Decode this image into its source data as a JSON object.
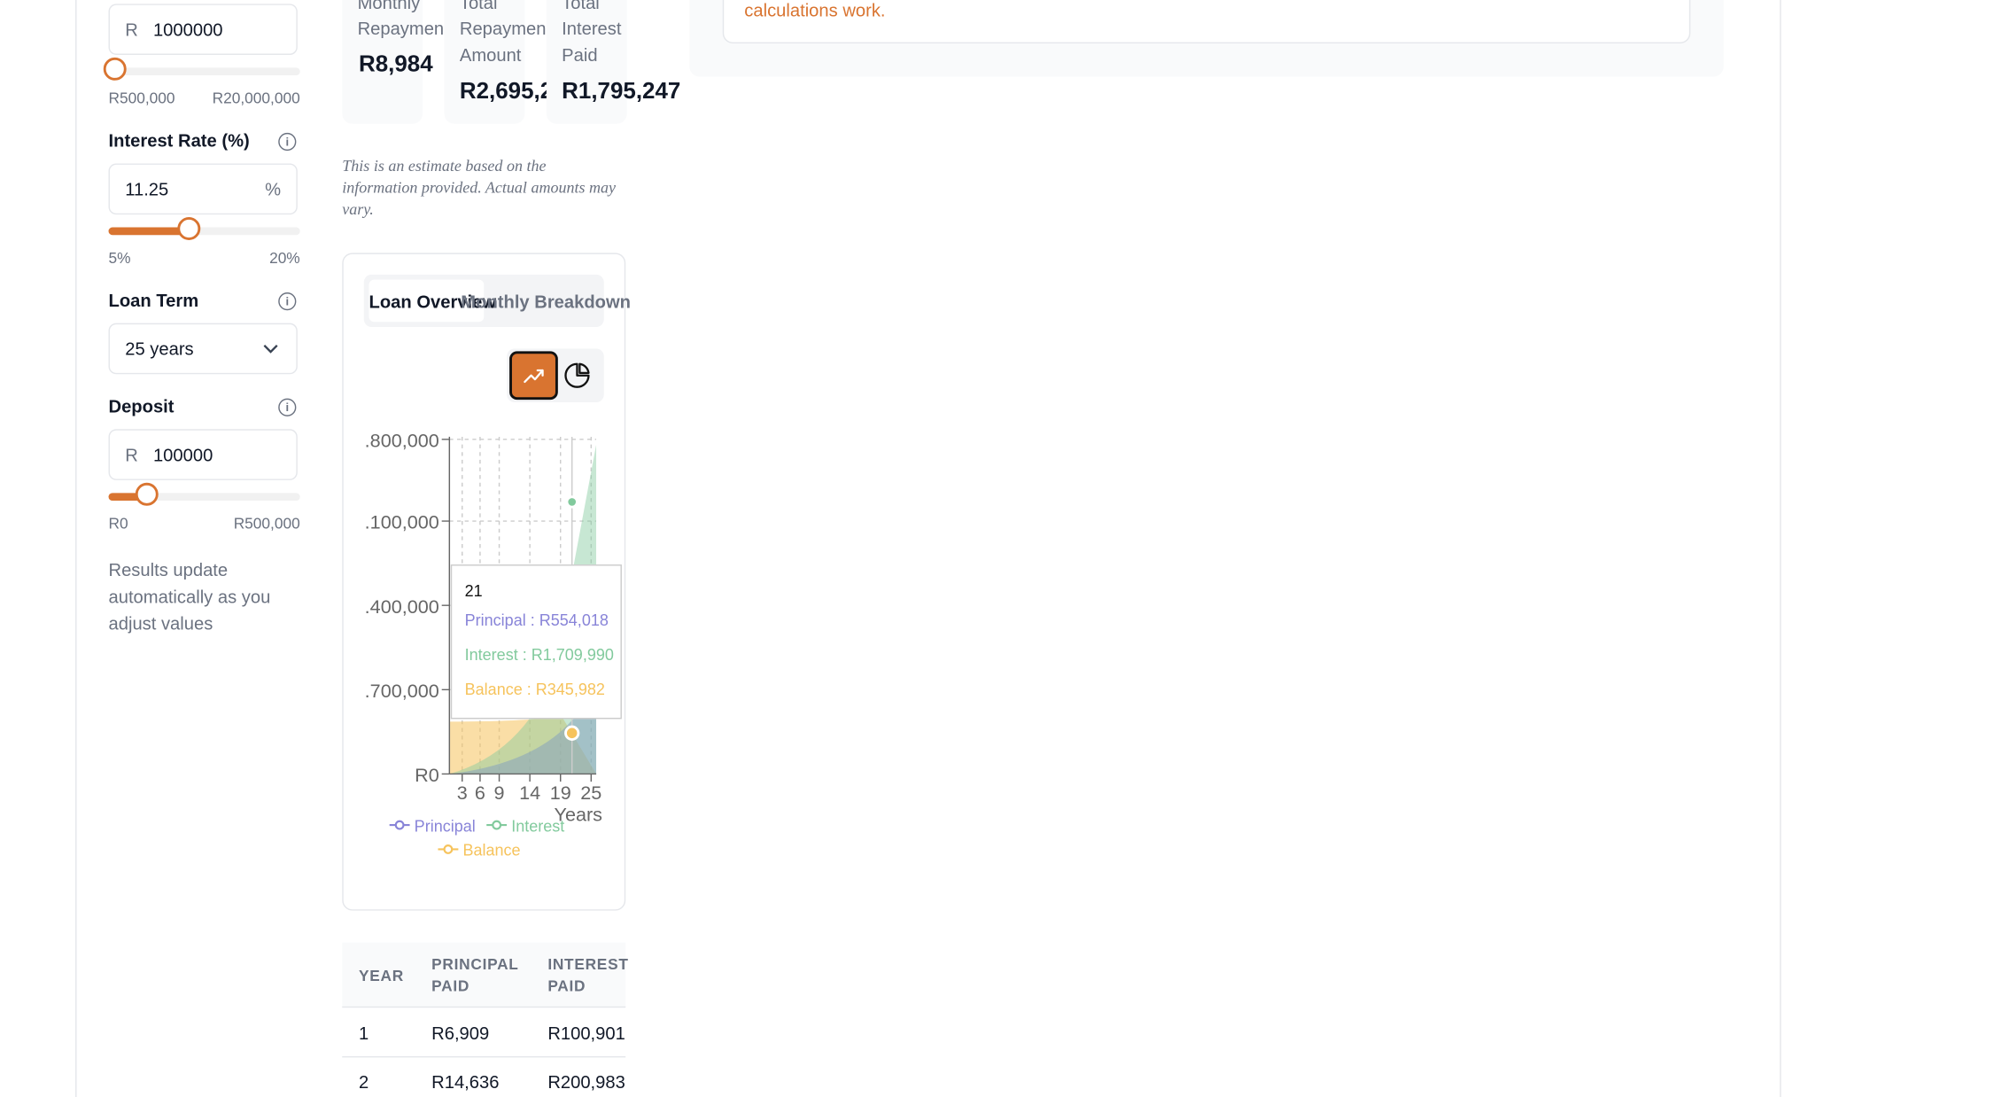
{
  "loan_amount": {
    "prefix": "R",
    "value": "1000000",
    "slider_fraction": 0.03,
    "min_label": "R500,000",
    "max_label": "R20,000,000"
  },
  "interest_rate": {
    "label": "Interest Rate (%)",
    "value": "11.25",
    "suffix": "%",
    "slider_fraction": 0.42,
    "min_label": "5%",
    "max_label": "20%"
  },
  "loan_term": {
    "label": "Loan Term",
    "value": "25 years"
  },
  "deposit": {
    "label": "Deposit",
    "prefix": "R",
    "value": "100000",
    "slider_fraction": 0.2,
    "min_label": "R0",
    "max_label": "R500,000"
  },
  "hint": "Results update automatically as you adjust values",
  "summary": {
    "monthly": {
      "title1": "Monthly",
      "title2": "Repaymen",
      "value": "R8,984"
    },
    "total": {
      "title1": "Total",
      "title2": "Repaymen",
      "title3": "Amount",
      "value": "R2,695,2"
    },
    "interest": {
      "title1": "Total",
      "title2": "Interest",
      "title3": "Paid",
      "value": "R1,795,247"
    }
  },
  "disclaimer": "This is an estimate based on the information provided. Actual amounts may vary.",
  "info_link": "calculations work.",
  "tabs": {
    "overview": "Loan Overview",
    "breakdown": "Monthly Breakdown"
  },
  "icons": {
    "line_chart": "trending-up-icon",
    "pie_chart": "pie-chart-icon",
    "info": "info-icon",
    "chevron": "chevron-down-icon"
  },
  "colors": {
    "accent": "#d97430",
    "principal": "#8884d8",
    "interest": "#82ca9d",
    "balance": "#f6c35c"
  },
  "chart_data": {
    "type": "area",
    "y_tick_labels": [
      ".800,000",
      ".100,000",
      ".400,000",
      ".700,000",
      "R0"
    ],
    "x_tick_labels": [
      "3",
      "6",
      "9",
      "14",
      "19",
      "25"
    ],
    "xlabel": "Years",
    "series": [
      {
        "name": "Principal"
      },
      {
        "name": "Interest"
      },
      {
        "name": "Balance"
      }
    ],
    "tooltip": {
      "year": "21",
      "principal": "Principal : R554,018",
      "interest": "Interest : R1,709,990",
      "balance": "Balance : R345,982"
    },
    "grid": true,
    "legend": "bottom"
  },
  "table": {
    "headers": [
      [
        "YEAR",
        ""
      ],
      [
        "PRINCIPAL",
        "PAID"
      ],
      [
        "INTEREST",
        "PAID"
      ]
    ],
    "rows": [
      [
        "1",
        "R6,909",
        "R100,901"
      ],
      [
        "2",
        "R14,636",
        "R200,983"
      ]
    ]
  }
}
